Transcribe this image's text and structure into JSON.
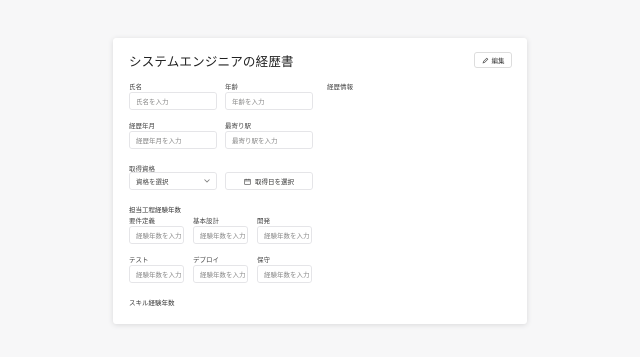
{
  "title": "システムエンジニアの経歴書",
  "edit_button": {
    "label": "編集",
    "icon": "pencil-icon"
  },
  "fields": {
    "name": {
      "label": "氏名",
      "placeholder": "氏名を入力"
    },
    "age": {
      "label": "年齢",
      "placeholder": "年齢を入力"
    },
    "career_info": {
      "label": "経歴情報"
    },
    "career_years": {
      "label": "経歴年月",
      "placeholder": "経歴年月を入力"
    },
    "station": {
      "label": "最寄り駅",
      "placeholder": "最寄り駅を入力"
    },
    "qualification": {
      "label": "取得資格",
      "select_value": "資格を選択",
      "date_button": "取得日を選択"
    }
  },
  "process_section": {
    "title": "担当工程経験年数",
    "items": [
      {
        "label": "要件定義",
        "placeholder": "経験年数を入力"
      },
      {
        "label": "基本設計",
        "placeholder": "経験年数を入力"
      },
      {
        "label": "開発",
        "placeholder": "経験年数を入力"
      },
      {
        "label": "テスト",
        "placeholder": "経験年数を入力"
      },
      {
        "label": "デプロイ",
        "placeholder": "経験年数を入力"
      },
      {
        "label": "保守",
        "placeholder": "経験年数を入力"
      }
    ]
  },
  "skill_section": {
    "title": "スキル経験年数"
  }
}
